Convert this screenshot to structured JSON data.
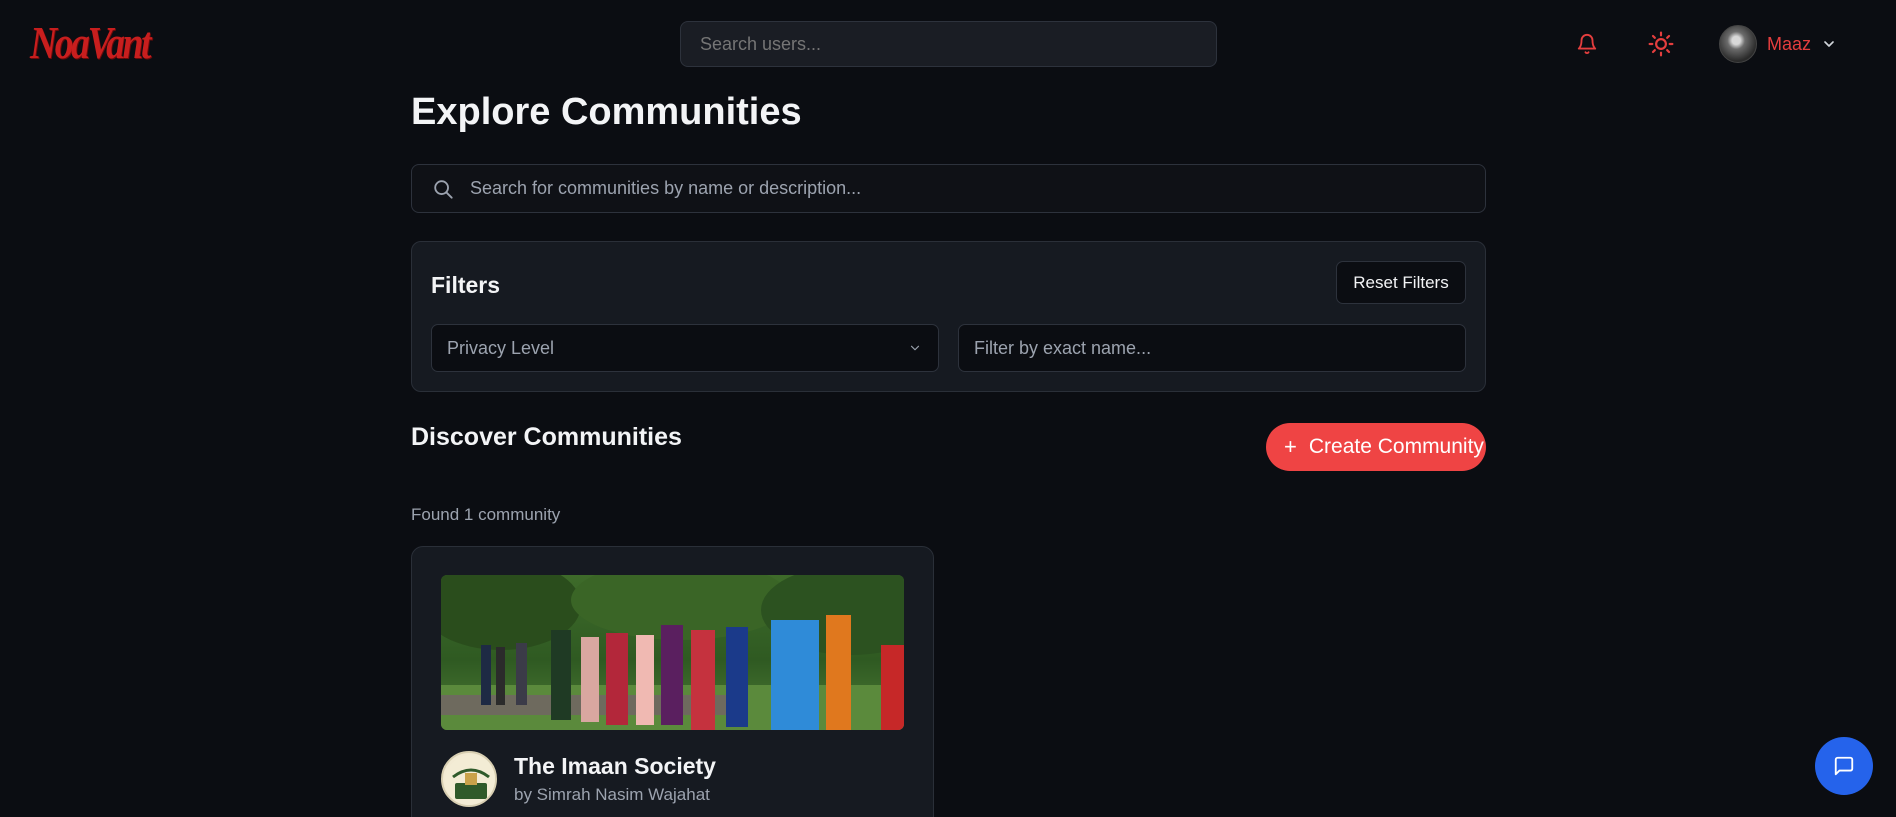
{
  "header": {
    "logo_text": "NoaVant",
    "search_placeholder": "Search users...",
    "user_name": "Maaz"
  },
  "main": {
    "title": "Explore Communities",
    "search_placeholder": "Search for communities by name or description...",
    "filters": {
      "title": "Filters",
      "reset_label": "Reset Filters",
      "privacy_selected": "Privacy Level",
      "exact_name_placeholder": "Filter by exact name..."
    },
    "discover": {
      "title": "Discover Communities",
      "create_label": "Create Community",
      "found_text": "Found 1 community"
    },
    "communities": [
      {
        "name": "The Imaan Society",
        "owner": "by Simrah Nasim Wajahat"
      }
    ]
  },
  "colors": {
    "background": "#0b0d12",
    "accent_red": "#ef4444",
    "brand_red": "#c81e1e",
    "chat_blue": "#2563eb"
  },
  "icons": [
    "bell-icon",
    "sun-icon",
    "chevron-down-icon",
    "search-icon",
    "plus-icon",
    "chat-icon"
  ]
}
